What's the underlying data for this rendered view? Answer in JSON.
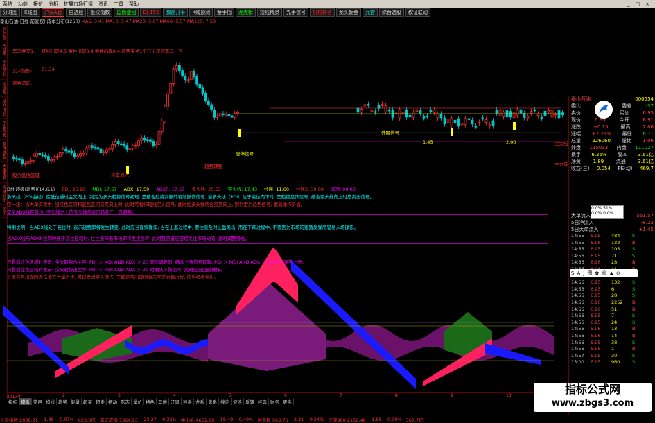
{
  "menubar": {
    "items": [
      "系统",
      "功能",
      "报价",
      "分析",
      "扩展市场行情",
      "资讯",
      "工具",
      "帮助"
    ],
    "window_controls": [
      "_",
      "□",
      "×"
    ]
  },
  "toolbar": {
    "items": [
      "分时图",
      "K线图",
      "沪深A股",
      "自选股",
      "板块指数",
      "国债逆回",
      "DJ 152",
      "预测开平",
      "K线预测",
      "金手指",
      "龙虎榜",
      "短线精灵",
      "先手信号",
      "机构排名",
      "龙头掘金",
      "九宫",
      "综合选股",
      "权证联动"
    ]
  },
  "infobar": {
    "stock": "泰山石油(日线 前复权)",
    "ma_label": "成本分布(1250)",
    "ma_values": [
      "MA5: 3.41",
      "MA10: 5.47",
      "MA20: 5.07",
      "MA60: 5.57"
    ],
    "extra": "MA120: 7.58"
  },
  "left_axis": {
    "labels": [
      "分时图",
      "K线图",
      "个股资料",
      "自选股",
      "综合排名",
      "牛股列表",
      "条件选股",
      "大盘走势",
      "板块分析",
      "资讯"
    ]
  },
  "main_annotations": [
    {
      "text": "黑马金叉1:",
      "color": "#ff3030"
    },
    {
      "text": "红线出现4.5 金柱出现0.4 金柱出现0.4 趋势买点1个已出现的黑马一号",
      "color": "#ff3030"
    },
    {
      "text": "买入指标:",
      "color": "#ff3030"
    },
    {
      "text": "81.34",
      "color": "#ff3030"
    },
    {
      "text": "资金流向:",
      "color": "#ff3030"
    },
    {
      "text": "低吸信号",
      "color": "#ffff00"
    },
    {
      "text": "股价低估区域",
      "color": "#ff3030"
    },
    {
      "text": "涨停信号",
      "color": "#ffff00"
    },
    {
      "text": "趋势转强",
      "color": "#ff3030"
    },
    {
      "text": "资金流入",
      "color": "#ff3030"
    },
    {
      "text": "主力出货",
      "color": "#ff3030"
    },
    {
      "text": "主力吸筹",
      "color": "#ff3030"
    },
    {
      "text": "1.45",
      "color": "#ffff00"
    },
    {
      "text": "2.00",
      "color": "#ffff00"
    }
  ],
  "indicator1_bar": {
    "items": [
      {
        "text": "DMI超级(趋势)(14,6,1)",
        "color": "#ccc"
      },
      {
        "text": "PDI: 26.10",
        "color": "#ff3030"
      },
      {
        "text": "MDI: 17.67",
        "color": "#00ff00"
      },
      {
        "text": "ADX: 17.59",
        "color": "#ffff00"
      },
      {
        "text": "ADXR: 17.57",
        "color": "#ff00ff"
      },
      {
        "text": "多头线: 25.63",
        "color": "#ff3030"
      },
      {
        "text": "空头线: 17.43",
        "color": "#00ff00"
      },
      {
        "text": "抄底: 11.60",
        "color": "#ffff00"
      },
      {
        "text": "抄底2: 30.00",
        "color": "#ff3030"
      },
      {
        "text": "逃顶: 90.00",
        "color": "#ff00ff"
      }
    ]
  },
  "text_lines": [
    {
      "text": "多头线（PDI曲线）在低位通过金叉向上, 判定为多头趋势信号初现, 是结合趋势判断的有效操作信号, 当多头线（PDI）位于高位向下时, 是趋势见顶信号, 结合空头线向上时是卖出信号。",
      "color": "#00ffff"
    },
    {
      "text": "空一级：当大单买卖中, 当红色区间和蓝色区间交叉向上时, 此时可看作短线买入信号, 此时如多头线结合交叉向上, 则判定为趋势信号, 更具操作价值。",
      "color": "#ff3030"
    },
    {
      "text": "安全ADX线在低位, 空头线之上的多头线代表市场处于上升趋势。",
      "color": "#ff00ff"
    },
    {
      "text": "特别说明：当ADX线处于高位时, 表示趋势即将发生转变, 此时应当谨慎操作; 当在上涨过程中, 要注意及时止盈离场, 而在下跌过程中, 不要因为市场的短暂反弹而轻易入场操作。",
      "color": "#00ffff"
    },
    {
      "text": "当ADX线与ADXR线同时处于高位区域时, 往往意味着市场即将发生反转, 此时投资者应密切关注市场动向, 适时调整持仓。",
      "color": "#ff00ff"
    },
    {
      "text": "只看到红色区域时表示: 多头趋势占主导, PDI ＞ MDI AND ADX ＞ 20 同时满足时, 确认上涨信号有效; PDI ＞ MDI AND ADX ＞ 40 时为强势上涨。",
      "color": "#ff00ff"
    },
    {
      "text": "只看到蓝色区域时表示: 空头趋势占主导, PDI ＜ MDI AND ADX ＞ 20 时确认下跌信号, 此时应当回避操作。",
      "color": "#ff00ff"
    },
    {
      "text": "上涨信号出现时表示多方力量占优, 可以考虑买入操作; 下跌信号出现时表示空方力量占优, 应当考虑卖出。",
      "color": "#ff3030"
    }
  ],
  "time_axis": {
    "labels": [
      "2013年",
      "2",
      "3",
      "4",
      "5",
      "6",
      "7",
      "8",
      "9",
      "10"
    ]
  },
  "bottom_tabs": {
    "items": [
      "指标",
      "模板",
      "常用",
      "均线",
      "趋势",
      "能量",
      "超买",
      "超卖",
      "摆动",
      "形态",
      "量价",
      "特色",
      "其他",
      "江恩",
      "神系",
      "龙系",
      "鬼系",
      "缠论",
      "波浪",
      "反转",
      "经典",
      "财务",
      "更多"
    ],
    "active": 1
  },
  "statusbar": {
    "items": [
      "上证指数 2039.21",
      "-1.38",
      "-0.07%",
      "623.0亿",
      "深证成指 7364.93",
      "-23.27",
      "-0.32%",
      "中小板 4651.80",
      "-18.49",
      "-0.40%",
      "创业板 963.76",
      "-2.31",
      "-0.24%",
      "沪深300 2156.46",
      "-1.88",
      "-0.09%",
      "367.7亿"
    ]
  },
  "right_panel": {
    "title": "泰山石油",
    "code": "000554",
    "rows": [
      {
        "label": "委比",
        "value": "-5.67",
        "color": "g"
      },
      {
        "label": "委差",
        "value": "-37",
        "color": "g"
      },
      {
        "label": "卖价",
        "value": "6.97",
        "color": "v"
      },
      {
        "label": "买价",
        "value": "6.95",
        "color": "v"
      },
      {
        "label": "现价",
        "value": "6.95",
        "color": "v"
      },
      {
        "label": "今开",
        "value": "6.91",
        "color": "v"
      },
      {
        "label": "涨跌",
        "value": "+0.15",
        "color": "v"
      },
      {
        "label": "最高",
        "value": "7.06",
        "color": "v"
      },
      {
        "label": "涨幅",
        "value": "+2.21%",
        "color": "v"
      },
      {
        "label": "最低",
        "value": "6.71",
        "color": "g"
      },
      {
        "label": "总量",
        "value": "226060",
        "color": "y"
      },
      {
        "label": "量比",
        "value": "1.06",
        "color": "v"
      },
      {
        "label": "外盘",
        "value": "115033",
        "color": "v"
      },
      {
        "label": "内盘",
        "value": "111027",
        "color": "g"
      },
      {
        "label": "换手",
        "value": "6.26%",
        "color": "y"
      },
      {
        "label": "股本",
        "value": "3.61亿",
        "color": "y"
      },
      {
        "label": "净资",
        "value": "1.89",
        "color": "y"
      },
      {
        "label": "流通",
        "value": "3.61亿",
        "color": "y"
      },
      {
        "label": "收益(三)",
        "value": "0.054",
        "color": "y"
      },
      {
        "label": "PE(动)",
        "value": "469.7",
        "color": "y"
      }
    ],
    "flow_rows": [
      {
        "label": "大单流入",
        "value": "551.57"
      },
      {
        "label": "5日净流入",
        "value": "-8.22"
      },
      {
        "label": "5日大单流入",
        "value": "+1.45"
      }
    ],
    "ticks": [
      {
        "time": "14:55",
        "price": "6.95",
        "vol": "484",
        "flag": "S"
      },
      {
        "time": "14:55",
        "price": "6.96",
        "vol": "122",
        "flag": "B"
      },
      {
        "time": "14:55",
        "price": "6.95",
        "vol": "105",
        "flag": "S"
      },
      {
        "time": "14:56",
        "price": "6.95",
        "vol": "71",
        "flag": "S"
      },
      {
        "time": "14:56",
        "price": "6.96",
        "vol": "28",
        "flag": "B"
      },
      {
        "time": "14:56",
        "price": "6.96",
        "vol": "41",
        "flag": "B"
      },
      {
        "time": "14:56",
        "price": "6.96",
        "vol": "17",
        "flag": "B"
      },
      {
        "time": "14:56",
        "price": "6.95",
        "vol": "132",
        "flag": "S"
      },
      {
        "time": "14:56",
        "price": "6.95",
        "vol": "6",
        "flag": "S"
      },
      {
        "time": "14:56",
        "price": "6.95",
        "vol": "28",
        "flag": "S"
      },
      {
        "time": "14:56",
        "price": "6.96",
        "vol": "2252",
        "flag": "B"
      },
      {
        "time": "14:56",
        "price": "6.96",
        "vol": "51",
        "flag": "B"
      },
      {
        "time": "14:56",
        "price": "6.95",
        "vol": "7",
        "flag": "S"
      },
      {
        "time": "14:56",
        "price": "6.95",
        "vol": "24",
        "flag": "S"
      },
      {
        "time": "14:56",
        "price": "6.96",
        "vol": "13",
        "flag": "B"
      },
      {
        "time": "14:56",
        "price": "6.96",
        "vol": "14",
        "flag": "B"
      },
      {
        "time": "14:56",
        "price": "6.95",
        "vol": "38",
        "flag": "S"
      },
      {
        "time": "14:56",
        "price": "6.96",
        "vol": "1",
        "flag": "B"
      },
      {
        "time": "14:57",
        "price": "6.95",
        "vol": "30",
        "flag": "S"
      },
      {
        "time": "15:00",
        "price": "6.95",
        "vol": "960",
        "flag": "S"
      }
    ]
  },
  "floatbox": {
    "lines": [
      "0.0% 51%",
      "0.0% 0.0%"
    ]
  },
  "saj_bar": {
    "items": [
      "S",
      "A",
      "J",
      "图",
      "✿",
      "☺",
      "▲",
      "⊕"
    ]
  },
  "watermark": {
    "title": "指标公式网",
    "url": "www.zbgs3.com"
  },
  "colors": {
    "up": "#ff3030",
    "down": "#00c8c8",
    "bg": "#000000",
    "magenta": "#a0007a",
    "blue": "#1010ff",
    "pink": "#ff2060",
    "green": "#1a6a1a"
  }
}
